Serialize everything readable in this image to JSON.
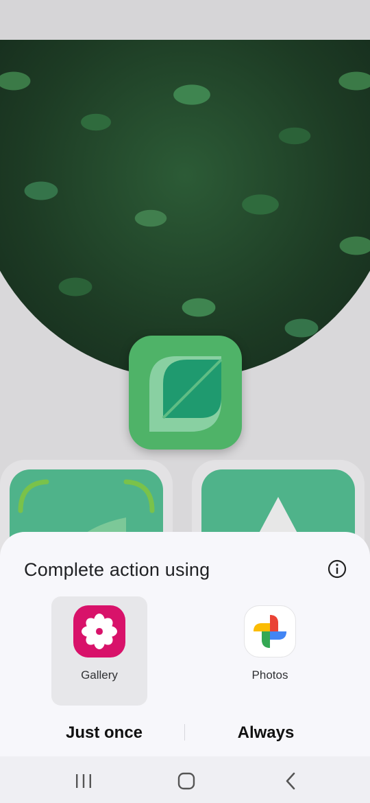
{
  "background_app": {
    "leaf_icon": "leaf-icon",
    "accent": "#4fb368"
  },
  "sheet": {
    "title": "Complete action using",
    "info_icon": "info-icon",
    "apps": [
      {
        "label": "Gallery",
        "icon": "gallery-flower-icon",
        "color": "#d8126a",
        "selected": true
      },
      {
        "label": "Photos",
        "icon": "photos-pinwheel-icon",
        "selected": false
      }
    ],
    "just_once": "Just once",
    "always": "Always"
  },
  "nav": {
    "recent": "recent-apps-icon",
    "home": "home-icon",
    "back": "back-icon"
  }
}
